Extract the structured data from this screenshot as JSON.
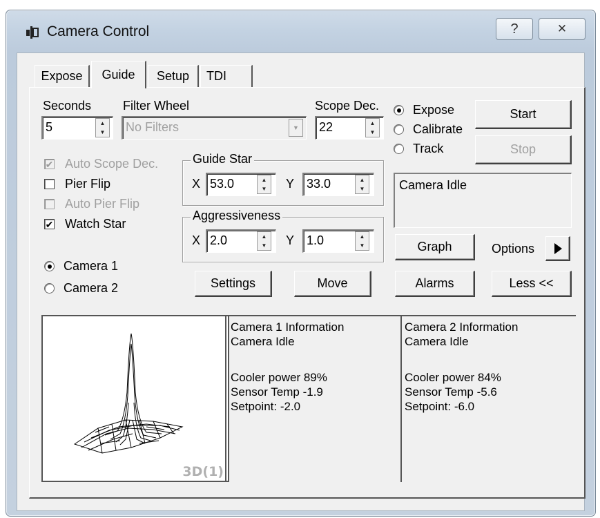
{
  "window": {
    "title": "Camera Control",
    "help_label": "?",
    "close_label": "✕"
  },
  "tabs": [
    {
      "label": "Expose",
      "active": false
    },
    {
      "label": "Guide",
      "active": true
    },
    {
      "label": "Setup",
      "active": false
    },
    {
      "label": "TDI",
      "active": false
    }
  ],
  "guide": {
    "seconds_label": "Seconds",
    "seconds_value": "5",
    "filter_wheel_label": "Filter Wheel",
    "filter_wheel_value": "No Filters",
    "scope_dec_label": "Scope Dec.",
    "scope_dec_value": "22",
    "mode_options": [
      {
        "label": "Expose",
        "selected": true
      },
      {
        "label": "Calibrate",
        "selected": false
      },
      {
        "label": "Track",
        "selected": false
      }
    ],
    "start_label": "Start",
    "stop_label": "Stop",
    "status_text": "Camera Idle",
    "auto_scope_dec_label": "Auto Scope Dec.",
    "pier_flip_label": "Pier Flip",
    "auto_pier_flip_label": "Auto Pier Flip",
    "watch_star_label": "Watch Star",
    "guide_star_title": "Guide Star",
    "guide_star_x_label": "X",
    "guide_star_x": "53.0",
    "guide_star_y_label": "Y",
    "guide_star_y": "33.0",
    "aggressiveness_title": "Aggressiveness",
    "aggr_x_label": "X",
    "aggr_x": "2.0",
    "aggr_y_label": "Y",
    "aggr_y": "1.0",
    "camera_options": [
      {
        "label": "Camera 1",
        "selected": true
      },
      {
        "label": "Camera 2",
        "selected": false
      }
    ],
    "settings_label": "Settings",
    "move_label": "Move",
    "graph_label": "Graph",
    "options_label": "Options",
    "alarms_label": "Alarms",
    "less_label": "Less <<",
    "plot_label": "3D(1)"
  },
  "camera1_info": {
    "title": "Camera 1 Information",
    "status": "Camera Idle",
    "cooler": "Cooler power 89%",
    "sensor": "Sensor Temp -1.9",
    "setpoint": "Setpoint: -2.0"
  },
  "camera2_info": {
    "title": "Camera 2 Information",
    "status": "Camera Idle",
    "cooler": "Cooler power 84%",
    "sensor": "Sensor Temp -5.6",
    "setpoint": "Setpoint: -6.0"
  },
  "colors": {
    "frame": "#c3d2e2",
    "face": "#f0f0f0",
    "disabled_text": "#a0a0a0"
  }
}
